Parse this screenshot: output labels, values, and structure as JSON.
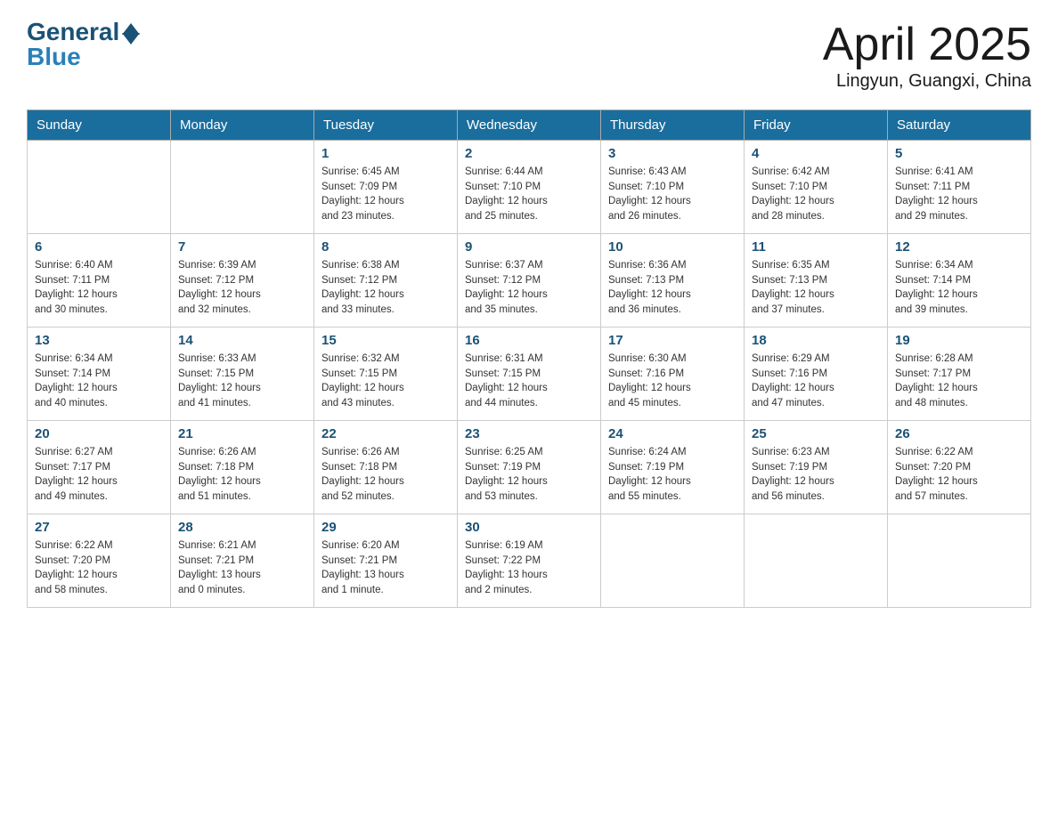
{
  "logo": {
    "general": "General",
    "blue": "Blue"
  },
  "title": "April 2025",
  "subtitle": "Lingyun, Guangxi, China",
  "days_of_week": [
    "Sunday",
    "Monday",
    "Tuesday",
    "Wednesday",
    "Thursday",
    "Friday",
    "Saturday"
  ],
  "weeks": [
    [
      {
        "day": "",
        "info": ""
      },
      {
        "day": "",
        "info": ""
      },
      {
        "day": "1",
        "info": "Sunrise: 6:45 AM\nSunset: 7:09 PM\nDaylight: 12 hours\nand 23 minutes."
      },
      {
        "day": "2",
        "info": "Sunrise: 6:44 AM\nSunset: 7:10 PM\nDaylight: 12 hours\nand 25 minutes."
      },
      {
        "day": "3",
        "info": "Sunrise: 6:43 AM\nSunset: 7:10 PM\nDaylight: 12 hours\nand 26 minutes."
      },
      {
        "day": "4",
        "info": "Sunrise: 6:42 AM\nSunset: 7:10 PM\nDaylight: 12 hours\nand 28 minutes."
      },
      {
        "day": "5",
        "info": "Sunrise: 6:41 AM\nSunset: 7:11 PM\nDaylight: 12 hours\nand 29 minutes."
      }
    ],
    [
      {
        "day": "6",
        "info": "Sunrise: 6:40 AM\nSunset: 7:11 PM\nDaylight: 12 hours\nand 30 minutes."
      },
      {
        "day": "7",
        "info": "Sunrise: 6:39 AM\nSunset: 7:12 PM\nDaylight: 12 hours\nand 32 minutes."
      },
      {
        "day": "8",
        "info": "Sunrise: 6:38 AM\nSunset: 7:12 PM\nDaylight: 12 hours\nand 33 minutes."
      },
      {
        "day": "9",
        "info": "Sunrise: 6:37 AM\nSunset: 7:12 PM\nDaylight: 12 hours\nand 35 minutes."
      },
      {
        "day": "10",
        "info": "Sunrise: 6:36 AM\nSunset: 7:13 PM\nDaylight: 12 hours\nand 36 minutes."
      },
      {
        "day": "11",
        "info": "Sunrise: 6:35 AM\nSunset: 7:13 PM\nDaylight: 12 hours\nand 37 minutes."
      },
      {
        "day": "12",
        "info": "Sunrise: 6:34 AM\nSunset: 7:14 PM\nDaylight: 12 hours\nand 39 minutes."
      }
    ],
    [
      {
        "day": "13",
        "info": "Sunrise: 6:34 AM\nSunset: 7:14 PM\nDaylight: 12 hours\nand 40 minutes."
      },
      {
        "day": "14",
        "info": "Sunrise: 6:33 AM\nSunset: 7:15 PM\nDaylight: 12 hours\nand 41 minutes."
      },
      {
        "day": "15",
        "info": "Sunrise: 6:32 AM\nSunset: 7:15 PM\nDaylight: 12 hours\nand 43 minutes."
      },
      {
        "day": "16",
        "info": "Sunrise: 6:31 AM\nSunset: 7:15 PM\nDaylight: 12 hours\nand 44 minutes."
      },
      {
        "day": "17",
        "info": "Sunrise: 6:30 AM\nSunset: 7:16 PM\nDaylight: 12 hours\nand 45 minutes."
      },
      {
        "day": "18",
        "info": "Sunrise: 6:29 AM\nSunset: 7:16 PM\nDaylight: 12 hours\nand 47 minutes."
      },
      {
        "day": "19",
        "info": "Sunrise: 6:28 AM\nSunset: 7:17 PM\nDaylight: 12 hours\nand 48 minutes."
      }
    ],
    [
      {
        "day": "20",
        "info": "Sunrise: 6:27 AM\nSunset: 7:17 PM\nDaylight: 12 hours\nand 49 minutes."
      },
      {
        "day": "21",
        "info": "Sunrise: 6:26 AM\nSunset: 7:18 PM\nDaylight: 12 hours\nand 51 minutes."
      },
      {
        "day": "22",
        "info": "Sunrise: 6:26 AM\nSunset: 7:18 PM\nDaylight: 12 hours\nand 52 minutes."
      },
      {
        "day": "23",
        "info": "Sunrise: 6:25 AM\nSunset: 7:19 PM\nDaylight: 12 hours\nand 53 minutes."
      },
      {
        "day": "24",
        "info": "Sunrise: 6:24 AM\nSunset: 7:19 PM\nDaylight: 12 hours\nand 55 minutes."
      },
      {
        "day": "25",
        "info": "Sunrise: 6:23 AM\nSunset: 7:19 PM\nDaylight: 12 hours\nand 56 minutes."
      },
      {
        "day": "26",
        "info": "Sunrise: 6:22 AM\nSunset: 7:20 PM\nDaylight: 12 hours\nand 57 minutes."
      }
    ],
    [
      {
        "day": "27",
        "info": "Sunrise: 6:22 AM\nSunset: 7:20 PM\nDaylight: 12 hours\nand 58 minutes."
      },
      {
        "day": "28",
        "info": "Sunrise: 6:21 AM\nSunset: 7:21 PM\nDaylight: 13 hours\nand 0 minutes."
      },
      {
        "day": "29",
        "info": "Sunrise: 6:20 AM\nSunset: 7:21 PM\nDaylight: 13 hours\nand 1 minute."
      },
      {
        "day": "30",
        "info": "Sunrise: 6:19 AM\nSunset: 7:22 PM\nDaylight: 13 hours\nand 2 minutes."
      },
      {
        "day": "",
        "info": ""
      },
      {
        "day": "",
        "info": ""
      },
      {
        "day": "",
        "info": ""
      }
    ]
  ]
}
